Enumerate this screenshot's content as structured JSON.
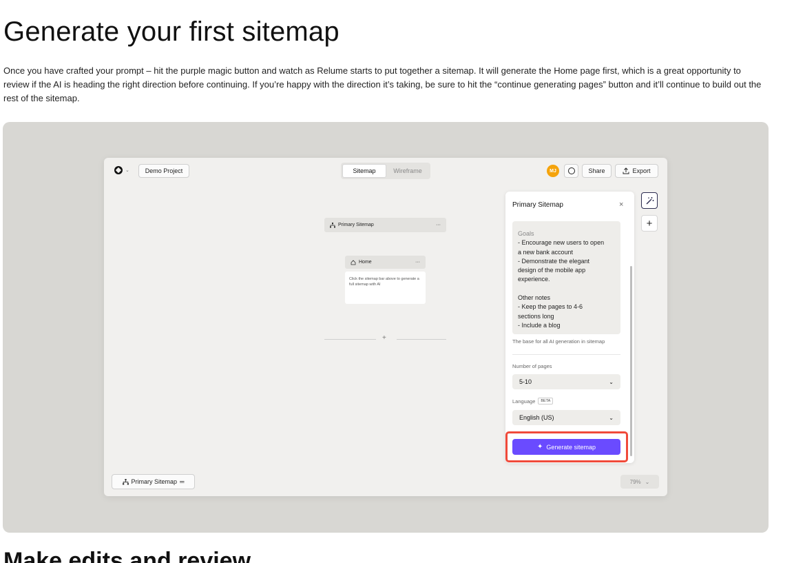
{
  "article": {
    "title": "Generate your first sitemap",
    "intro": "Once you have crafted your prompt – hit the purple magic button and watch as Relume starts to put together a sitemap. It will generate the Home page first, which is a great opportunity to review if the AI is heading the right direction before continuing. If you’re happy with the direction it’s taking, be sure to hit the “continue generating pages” button and it’ll continue to build out the rest of the sitemap.",
    "next_heading": "Make edits and review"
  },
  "app": {
    "project_label": "Demo Project",
    "tabs": [
      {
        "label": "Sitemap",
        "active": true
      },
      {
        "label": "Wireframe",
        "active": false
      }
    ],
    "avatar_initials": "MJ",
    "share_label": "Share",
    "export_label": "Export",
    "canvas": {
      "sitemap_node_label": "Primary Sitemap",
      "node_menu": "···",
      "home_node_label": "Home",
      "home_card_text": "Click the sitemap bar above to generate a full sitemap with AI",
      "add_symbol": "+"
    },
    "panel": {
      "title": "Primary Sitemap",
      "close_symbol": "×",
      "prompt_lines_muted": [
        "Goals"
      ],
      "prompt_lines": [
        "- Encourage new users to open",
        "a new bank account",
        "- Demonstrate the elegant",
        "design of the mobile app",
        "experience.",
        "",
        "Other notes",
        "- Keep the pages to 4-6",
        "sections long",
        "- Include a blog"
      ],
      "helper_text": "The base for all AI generation in sitemap",
      "pages_label": "Number of pages",
      "pages_value": "5-10",
      "language_label": "Language",
      "language_badge": "BETA",
      "language_value": "English (US)",
      "generate_label": "Generate sitemap"
    },
    "bottom_bar": {
      "sitemap_label": "Primary Sitemap",
      "menu_symbol": "═"
    },
    "zoom_value": "79%"
  },
  "colors": {
    "accent_purple": "#6a4bff",
    "highlight_red": "#f04a3a",
    "avatar_orange": "#f5a30b",
    "stage_bg": "#d8d7d3",
    "canvas_bg": "#f1f0ee"
  },
  "icons": [
    "relume-logo-icon",
    "chevron-down-icon",
    "comment-icon",
    "upload-icon",
    "close-icon",
    "magic-wand-icon",
    "plus-icon",
    "sitemap-icon",
    "home-icon",
    "sparkle-icon",
    "menu-icon"
  ]
}
